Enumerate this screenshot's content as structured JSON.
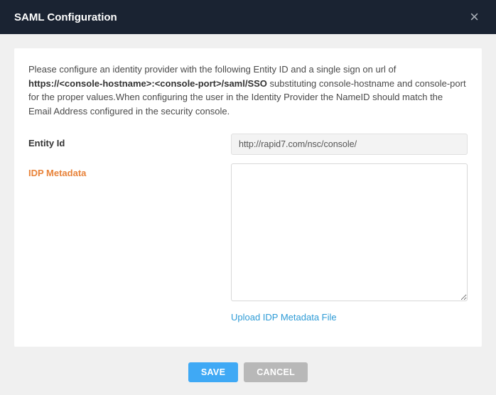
{
  "header": {
    "title": "SAML Configuration"
  },
  "description": {
    "part1": "Please configure an identity provider with the following Entity ID and a single sign on url of ",
    "bold1": "https://<console-hostname>:<console-port>/saml/SSO",
    "part2": " substituting console-hostname and console-port for the proper values.When configuring the user in the Identity Provider the NameID should match the Email Address configured in the security console."
  },
  "form": {
    "entity_id_label": "Entity Id",
    "entity_id_value": "http://rapid7.com/nsc/console/",
    "idp_metadata_label": "IDP Metadata",
    "idp_metadata_value": "",
    "upload_link": "Upload IDP Metadata File"
  },
  "footer": {
    "save_label": "SAVE",
    "cancel_label": "CANCEL"
  }
}
